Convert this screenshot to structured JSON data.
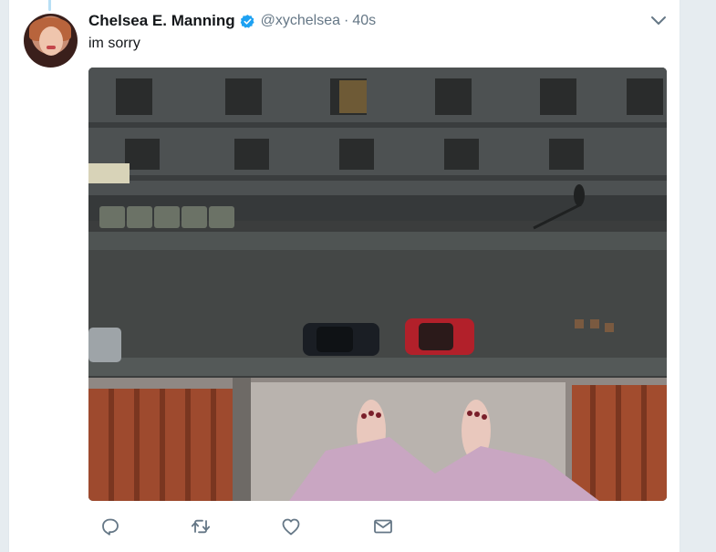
{
  "tweet": {
    "author_name": "Chelsea E. Manning",
    "handle": "@xychelsea",
    "separator": "·",
    "time": "40s",
    "text": "im sorry"
  },
  "icons": {
    "verified": "verified-badge-icon",
    "caret": "chevron-down-icon",
    "reply": "reply-icon",
    "retweet": "retweet-icon",
    "like": "heart-icon",
    "dm": "envelope-icon"
  },
  "colors": {
    "verified_blue": "#1da1f2",
    "icon_gray": "#657786",
    "text": "#14171a",
    "background": "#e6ecf0"
  }
}
